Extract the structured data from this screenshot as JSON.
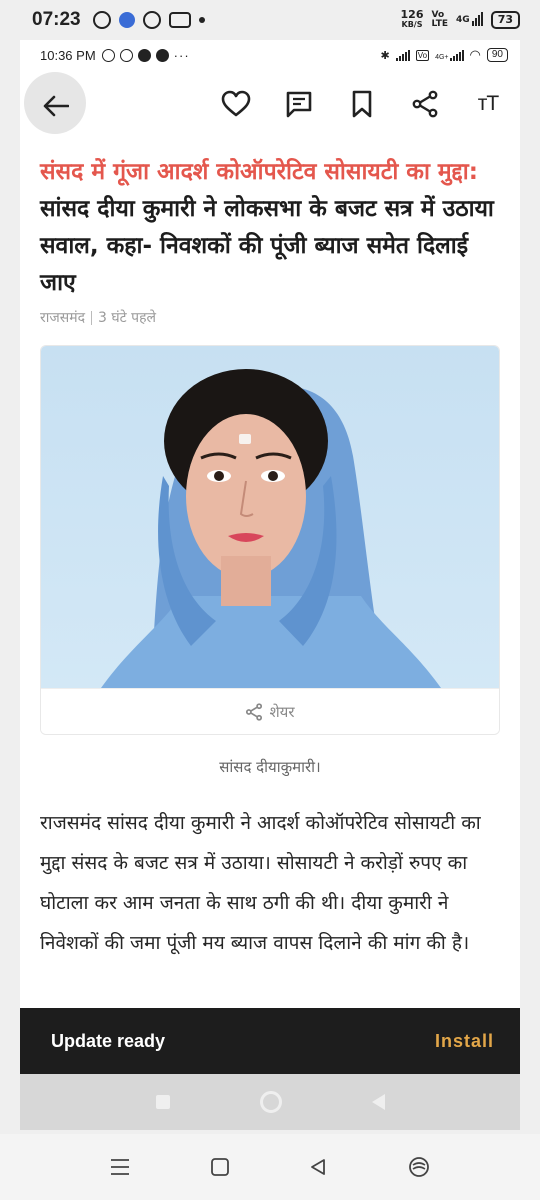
{
  "outer_status": {
    "time": "07:23",
    "speed_value": "126",
    "speed_unit": "KB/S",
    "network": "4G",
    "battery": "73"
  },
  "inner_status": {
    "time": "10:36 PM",
    "network": "4G+",
    "battery": "90"
  },
  "article": {
    "headline_highlight": "संसद में गूंजा आदर्श कोऑपरेटिव सोसायटी का मुद्दा:",
    "headline_rest": " सांसद दीया कुमारी ने लोकसभा के बजट सत्र में उठाया सवाल, कहा- निवशकों की पूंजी ब्याज समेत दिलाई जाए",
    "location": "राजसमंद",
    "time_ago": "3 घंटे पहले",
    "share_label": "शेयर",
    "caption": "सांसद दीयाकुमारी।",
    "body": "राजसमंद सांसद दीया कुमारी ने आदर्श कोऑपरेटिव सोसायटी का मुद्दा संसद के बजट सत्र में उठाया। सोसायटी ने करोड़ों रुपए का घोटाला कर आम जनता के साथ ठगी की थी। दीया कुमारी ने निवेशकों की जमा पूंजी मय ब्याज वापस दिलाने की मांग की है।"
  },
  "toolbar": {
    "font_size_label": "тT"
  },
  "snackbar": {
    "message": "Update ready",
    "action": "Install"
  },
  "colors": {
    "headline_accent": "#e4574d",
    "install_accent": "#e3a749",
    "snackbar_bg": "#1d1d1d"
  }
}
